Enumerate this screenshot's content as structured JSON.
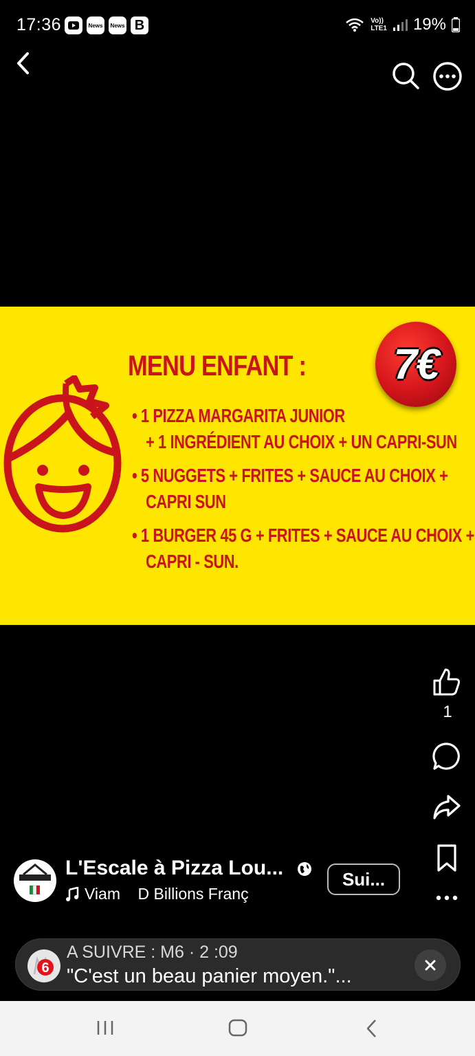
{
  "status_bar": {
    "time": "17:36",
    "left_icons": [
      "youtube-icon",
      "news-icon",
      "news-icon",
      "b-icon"
    ],
    "news_label": "News",
    "b_label": "B",
    "network_label_top": "Vo))",
    "network_label_bottom": "LTE1",
    "battery": "19%"
  },
  "post": {
    "image": {
      "title": "MENU ENFANT :",
      "price": "7€",
      "items": [
        "• 1 PIZZA MARGARITA JUNIOR",
        "+ 1 INGRÉDIENT AU CHOIX + UN CAPRI-SUN",
        "• 5 NUGGETS + FRITES + SAUCE AU CHOIX +",
        "CAPRI SUN",
        "• 1 BURGER 45 G + FRITES + SAUCE AU CHOIX +",
        "CAPRI - SUN."
      ],
      "background_color": "#ffe600",
      "accent_color": "#c8141a"
    },
    "like_count": "1",
    "author": {
      "name": "L'Escale à Pizza Lou...",
      "music_text": "Viam    D Billions Franç",
      "follow_label": "Sui..."
    }
  },
  "toast": {
    "line1": "A SUIVRE : M6 · 2 :09",
    "line2": "\"C'est un beau panier moyen.\"...",
    "logo_label": "6"
  },
  "icons": {
    "back": "back-arrow-icon",
    "search": "search-icon",
    "more": "more-icon",
    "like": "thumbs-up-icon",
    "comment": "comment-icon",
    "share": "share-icon",
    "save": "bookmark-icon"
  }
}
